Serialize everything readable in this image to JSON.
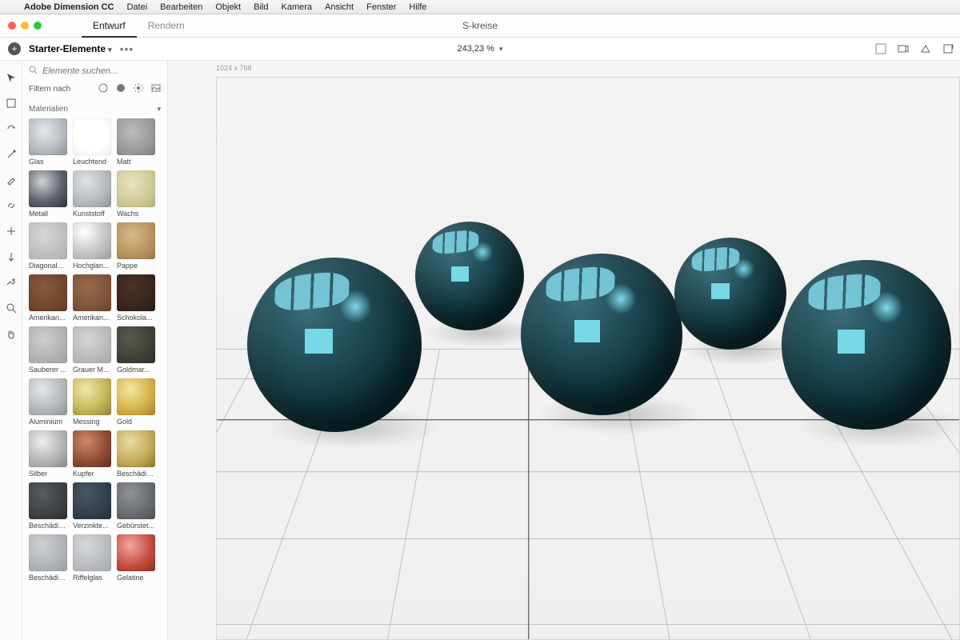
{
  "mac_menu": {
    "app_name": "Adobe Dimension CC",
    "items": [
      "Datei",
      "Bearbeiten",
      "Objekt",
      "Bild",
      "Kamera",
      "Ansicht",
      "Fenster",
      "Hilfe"
    ]
  },
  "doc_tabs": {
    "active": "Entwurf",
    "inactive": "Rendern"
  },
  "doc_title": "S-kreise",
  "starter_label": "Starter-Elemente",
  "zoom_label": "243,23 %",
  "canvas_dims": "1024 x 768",
  "search_placeholder": "Elemente suchen...",
  "filter_label": "Filtern nach",
  "section_label": "Materialien",
  "materials": [
    {
      "label": "Glas",
      "cls": "s-glas"
    },
    {
      "label": "Leuchtend",
      "cls": "s-leuchtend"
    },
    {
      "label": "Matt",
      "cls": "s-matt"
    },
    {
      "label": "Metall",
      "cls": "s-metall"
    },
    {
      "label": "Kunststoff",
      "cls": "s-kunststoff"
    },
    {
      "label": "Wachs",
      "cls": "s-wachs"
    },
    {
      "label": "Diagonalp...",
      "cls": "s-diag"
    },
    {
      "label": "Hochglan...",
      "cls": "s-hoch"
    },
    {
      "label": "Pappe",
      "cls": "s-pappe"
    },
    {
      "label": "Amerikan...",
      "cls": "s-eiche1"
    },
    {
      "label": "Amerikan...",
      "cls": "s-eiche2"
    },
    {
      "label": "Schokola...",
      "cls": "s-schoko"
    },
    {
      "label": "Sauberer ...",
      "cls": "s-sauber"
    },
    {
      "label": "Grauer M...",
      "cls": "s-marmor"
    },
    {
      "label": "Goldmar...",
      "cls": "s-goldm"
    },
    {
      "label": "Aluminium",
      "cls": "s-alu"
    },
    {
      "label": "Messing",
      "cls": "s-messing"
    },
    {
      "label": "Gold",
      "cls": "s-gold"
    },
    {
      "label": "Silber",
      "cls": "s-silber"
    },
    {
      "label": "Kupfer",
      "cls": "s-kupfer"
    },
    {
      "label": "Beschädig...",
      "cls": "s-besch"
    },
    {
      "label": "Beschädig...",
      "cls": "s-besch2"
    },
    {
      "label": "Verzinkte...",
      "cls": "s-verz"
    },
    {
      "label": "Gebürstet...",
      "cls": "s-geb"
    },
    {
      "label": "Beschädig...",
      "cls": "s-besch3"
    },
    {
      "label": "Riffelglas",
      "cls": "s-riffel"
    },
    {
      "label": "Gelatine",
      "cls": "s-gelatine"
    }
  ]
}
